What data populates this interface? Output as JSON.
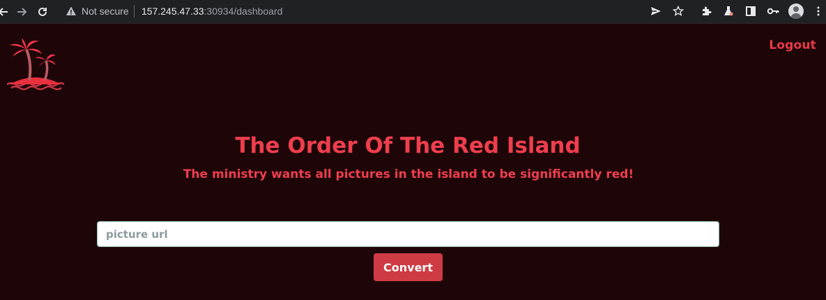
{
  "browser": {
    "security_label": "Not secure",
    "url_host": "157.245.47.33",
    "url_rest": ":30934/dashboard"
  },
  "header": {
    "logout_label": "Logout"
  },
  "main": {
    "title": "The Order Of The Red Island",
    "subtitle": "The ministry wants all pictures in the island to be significantly red!",
    "input_placeholder": "picture url",
    "input_value": "",
    "button_label": "Convert"
  },
  "colors": {
    "background": "#1e0608",
    "accent": "#ee3e4e",
    "button": "#cf3b44"
  },
  "icons": [
    "back-arrow-icon",
    "forward-arrow-icon",
    "reload-icon",
    "warning-icon",
    "send-icon",
    "star-icon",
    "extensions-icon",
    "flask-icon",
    "side-panel-icon",
    "key-icon",
    "account-icon",
    "more-vert-icon",
    "palm-island-logo"
  ]
}
